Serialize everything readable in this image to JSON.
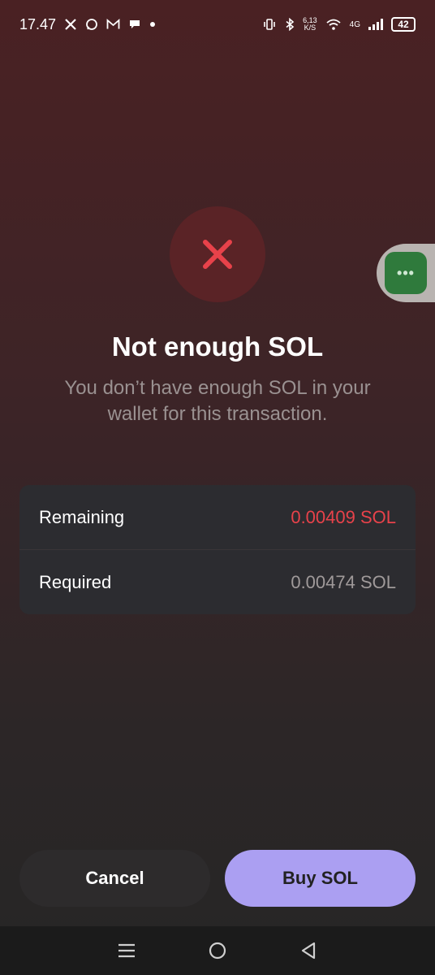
{
  "status_bar": {
    "time": "17.47",
    "speed_value": "6,13",
    "speed_unit": "K/S",
    "network": "4G",
    "battery": "42"
  },
  "dialog": {
    "title": "Not enough SOL",
    "message": "You don’t have enough SOL in your wallet for this transaction."
  },
  "details": {
    "rows": [
      {
        "label": "Remaining",
        "value": "0.00409 SOL"
      },
      {
        "label": "Required",
        "value": "0.00474 SOL"
      }
    ]
  },
  "actions": {
    "cancel_label": "Cancel",
    "buy_label": "Buy SOL"
  },
  "floating_bubble": {
    "label": "•••"
  },
  "colors": {
    "accent": "#ab9ff2",
    "error": "#e8424a",
    "error_circle": "#5a2326",
    "card": "#2c2c30"
  }
}
